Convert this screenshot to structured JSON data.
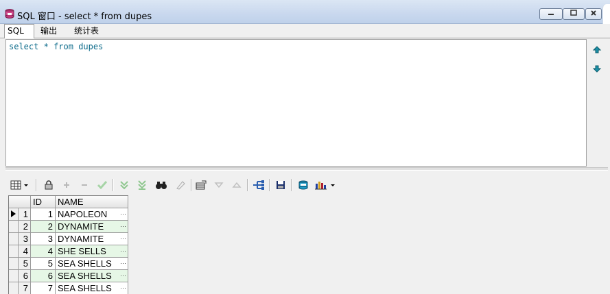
{
  "window": {
    "title": "SQL 窗口 - select * from dupes",
    "buttons": [
      "minimize",
      "maximize",
      "close"
    ]
  },
  "tabs": [
    {
      "label": "SQL",
      "active": true
    },
    {
      "label": "输出",
      "active": false
    },
    {
      "label": "统计表",
      "active": false
    }
  ],
  "editor": {
    "sql": {
      "kw1": "select",
      "star": "*",
      "kw2": "from",
      "table": "dupes"
    }
  },
  "side_buttons": [
    "arrow-up-icon",
    "arrow-down-icon"
  ],
  "grid": {
    "columns": [
      "ID",
      "NAME"
    ],
    "rows": [
      {
        "rownum": "1",
        "id": "1",
        "name": "NAPOLEON",
        "current": true
      },
      {
        "rownum": "2",
        "id": "2",
        "name": "DYNAMITE"
      },
      {
        "rownum": "3",
        "id": "3",
        "name": "DYNAMITE"
      },
      {
        "rownum": "4",
        "id": "4",
        "name": "SHE SELLS"
      },
      {
        "rownum": "5",
        "id": "5",
        "name": "SEA SHELLS"
      },
      {
        "rownum": "6",
        "id": "6",
        "name": "SEA SHELLS"
      },
      {
        "rownum": "7",
        "id": "7",
        "name": "SEA SHELLS"
      }
    ]
  },
  "colors": {
    "keyword": "#0b6a8a",
    "alt_row": "#e6f7e6",
    "title_bar": "#c9d8ee"
  }
}
